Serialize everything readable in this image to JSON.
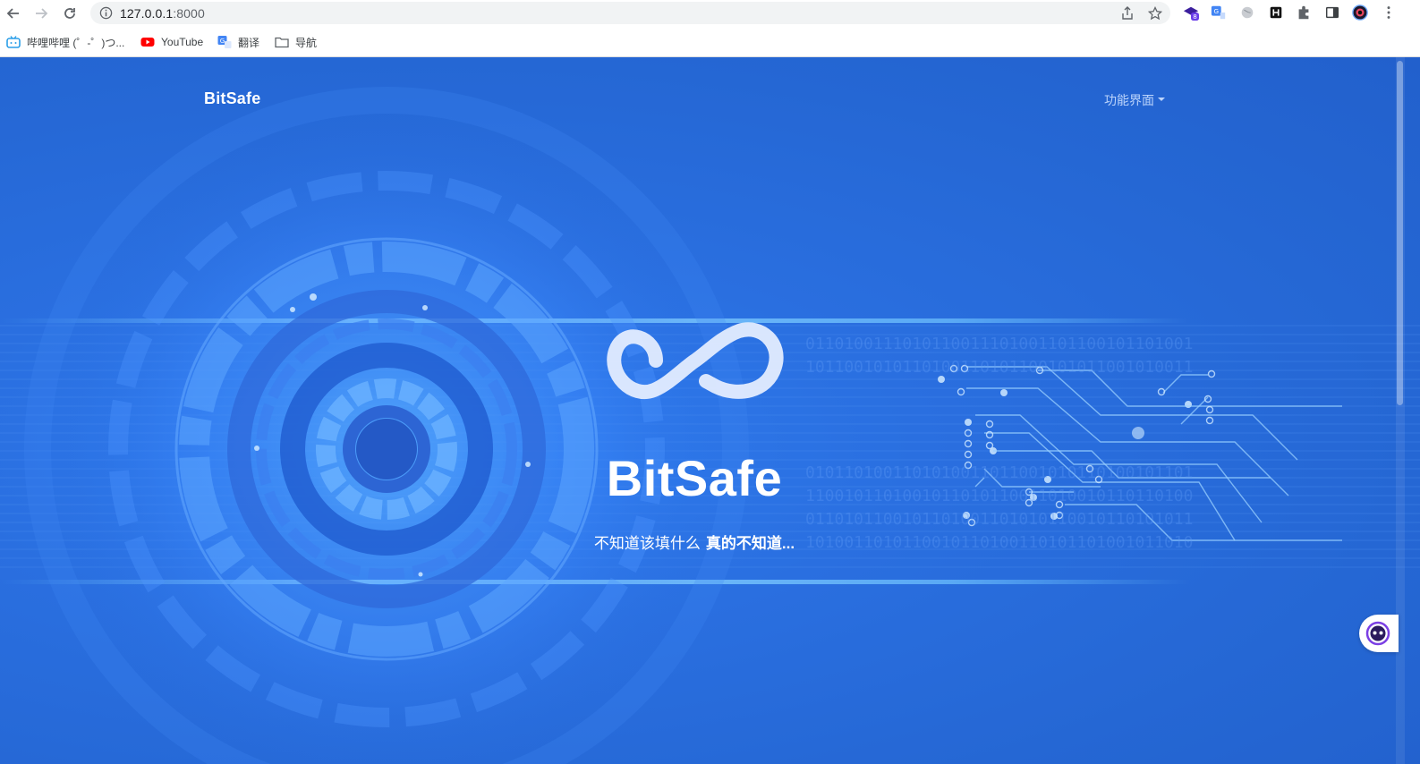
{
  "browser": {
    "url_host": "127.0.0.1",
    "url_port": ":8000",
    "extension_badge": "8"
  },
  "bookmarks": [
    {
      "label": "哔哩哔哩 (゜-゜)つ...",
      "icon": "bilibili-icon"
    },
    {
      "label": "YouTube",
      "icon": "youtube-icon"
    },
    {
      "label": "翻译",
      "icon": "translate-icon"
    },
    {
      "label": "导航",
      "icon": "folder-icon"
    }
  ],
  "page": {
    "brand": "BitSafe",
    "menu_label": "功能界面",
    "hero_title": "BitSafe",
    "hero_sub": "不知道该填什么",
    "hero_sub_strong": "真的不知道..."
  },
  "colors": {
    "background": "#2567d4",
    "accent_light": "#5aa7ff",
    "text": "#ffffff"
  }
}
